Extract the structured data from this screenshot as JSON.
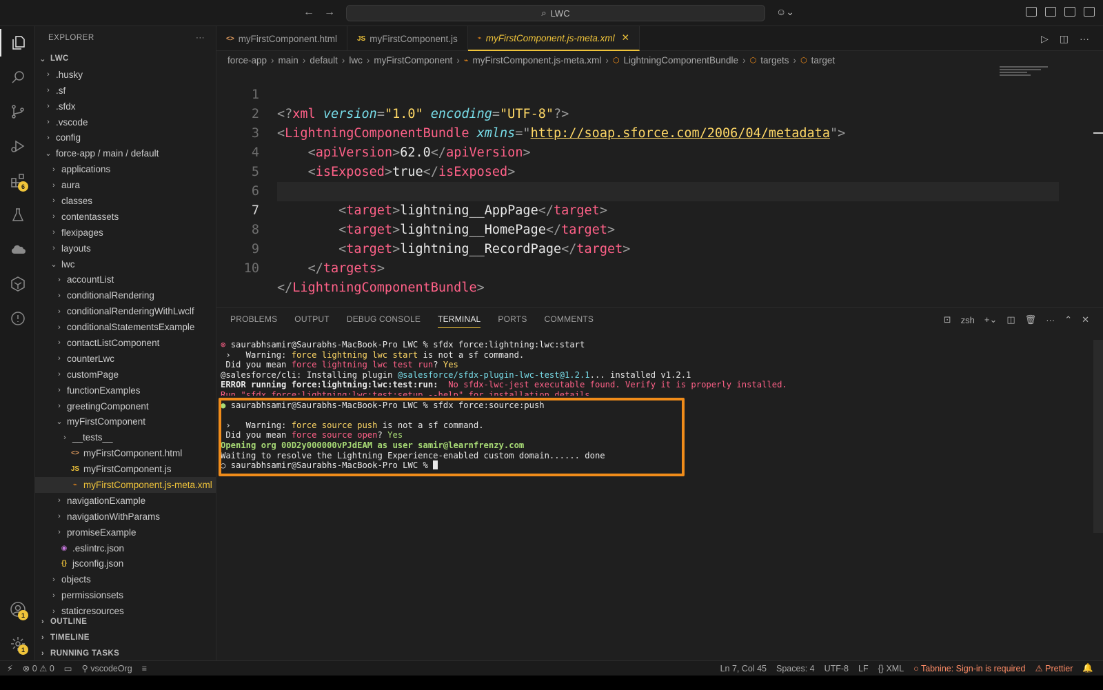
{
  "titlebar": {
    "search_text": "LWC"
  },
  "activity": {
    "extensions_badge": "6",
    "accounts_badge": "1",
    "settings_badge": "1"
  },
  "sidebar": {
    "title": "EXPLORER",
    "more": "···",
    "root": "LWC",
    "items": [
      {
        "label": ".husky",
        "depth": 1,
        "chev": "›"
      },
      {
        "label": ".sf",
        "depth": 1,
        "chev": "›"
      },
      {
        "label": ".sfdx",
        "depth": 1,
        "chev": "›"
      },
      {
        "label": ".vscode",
        "depth": 1,
        "chev": "›"
      },
      {
        "label": "config",
        "depth": 1,
        "chev": "›"
      },
      {
        "label": "force-app / main / default",
        "depth": 1,
        "chev": "⌄"
      },
      {
        "label": "applications",
        "depth": 2,
        "chev": "›"
      },
      {
        "label": "aura",
        "depth": 2,
        "chev": "›"
      },
      {
        "label": "classes",
        "depth": 2,
        "chev": "›"
      },
      {
        "label": "contentassets",
        "depth": 2,
        "chev": "›"
      },
      {
        "label": "flexipages",
        "depth": 2,
        "chev": "›"
      },
      {
        "label": "layouts",
        "depth": 2,
        "chev": "›"
      },
      {
        "label": "lwc",
        "depth": 2,
        "chev": "⌄"
      },
      {
        "label": "accountList",
        "depth": 3,
        "chev": "›"
      },
      {
        "label": "conditionalRendering",
        "depth": 3,
        "chev": "›"
      },
      {
        "label": "conditionalRenderingWithLwclf",
        "depth": 3,
        "chev": "›"
      },
      {
        "label": "conditionalStatementsExample",
        "depth": 3,
        "chev": "›"
      },
      {
        "label": "contactListComponent",
        "depth": 3,
        "chev": "›"
      },
      {
        "label": "counterLwc",
        "depth": 3,
        "chev": "›"
      },
      {
        "label": "customPage",
        "depth": 3,
        "chev": "›"
      },
      {
        "label": "functionExamples",
        "depth": 3,
        "chev": "›"
      },
      {
        "label": "greetingComponent",
        "depth": 3,
        "chev": "›"
      },
      {
        "label": "myFirstComponent",
        "depth": 3,
        "chev": "⌄"
      },
      {
        "label": "__tests__",
        "depth": 4,
        "chev": "›"
      },
      {
        "label": "myFirstComponent.html",
        "depth": 4,
        "icon": "<>",
        "icon_color": "#e8a060"
      },
      {
        "label": "myFirstComponent.js",
        "depth": 4,
        "icon": "JS",
        "icon_color": "#f0c43a"
      },
      {
        "label": "myFirstComponent.js-meta.xml",
        "depth": 4,
        "icon": "⌁",
        "icon_color": "#f08c1a",
        "selected": true
      },
      {
        "label": "navigationExample",
        "depth": 3,
        "chev": "›"
      },
      {
        "label": "navigationWithParams",
        "depth": 3,
        "chev": "›"
      },
      {
        "label": "promiseExample",
        "depth": 3,
        "chev": "›"
      },
      {
        "label": ".eslintrc.json",
        "depth": 2,
        "icon": "◉",
        "icon_color": "#c678dd"
      },
      {
        "label": "jsconfig.json",
        "depth": 2,
        "icon": "{}",
        "icon_color": "#f0c43a"
      },
      {
        "label": "objects",
        "depth": 2,
        "chev": "›"
      },
      {
        "label": "permissionsets",
        "depth": 2,
        "chev": "›"
      },
      {
        "label": "staticresources",
        "depth": 2,
        "chev": "›"
      }
    ],
    "outline": "OUTLINE",
    "timeline": "TIMELINE",
    "running_tasks": "RUNNING TASKS"
  },
  "tabs": [
    {
      "label": "myFirstComponent.html",
      "icon": "<>",
      "icon_color": "#e8a060"
    },
    {
      "label": "myFirstComponent.js",
      "icon": "JS",
      "icon_color": "#f0c43a"
    },
    {
      "label": "myFirstComponent.js-meta.xml",
      "icon": "⌁",
      "icon_color": "#f08c1a",
      "active": true
    }
  ],
  "breadcrumb": [
    "force-app",
    "main",
    "default",
    "lwc",
    "myFirstComponent",
    "myFirstComponent.js-meta.xml",
    "LightningComponentBundle",
    "targets",
    "target"
  ],
  "code": {
    "current_line": 7,
    "xml_decl": {
      "version": "\"1.0\"",
      "encoding": "\"UTF-8\""
    },
    "bundle_tag": "LightningComponentBundle",
    "xmlns_attr": "xmlns",
    "xmlns_value": "http://soap.sforce.com/2006/04/metadata",
    "api_tag": "apiVersion",
    "api_value": "62.0",
    "exposed_tag": "isExposed",
    "exposed_value": "true",
    "targets_tag": "targets",
    "target_tag": "target",
    "targets": [
      "lightning__AppPage",
      "lightning__HomePage",
      "lightning__RecordPage"
    ]
  },
  "panel": {
    "tabs": [
      "PROBLEMS",
      "OUTPUT",
      "DEBUG CONSOLE",
      "TERMINAL",
      "PORTS",
      "COMMENTS"
    ],
    "active_tab": "TERMINAL",
    "shell": "zsh"
  },
  "terminal": {
    "prompt": "saurabhsamir@Saurabhs-MacBook-Pro LWC %",
    "cmd1": "sfdx force:lightning:lwc:start",
    "warn1_pre": " ›   Warning: ",
    "warn1_cmd": "force lightning lwc start",
    "warn_post": " is not a sf command.",
    "mean1_pre": " Did you mean ",
    "mean1_cmd": "force lightning lwc test run",
    "mean_q": "? ",
    "yes": "Yes",
    "install_pre": "@salesforce/cli: Installing plugin ",
    "install_pkg": "@salesforce/sfdx-plugin-lwc-test@1.2.1",
    "install_post": "... installed v1.2.1",
    "error_pre": "ERROR running force:lightning:lwc:test:run:",
    "error_msg": "  No sfdx-lwc-jest executable found. Verify it is properly installed.",
    "clipped_line": "Run \"sfdx force:lightning:lwc:test:setup --help\" for installation details.",
    "cmd2": "sfdx force:source:push",
    "warn2_cmd": "force source push",
    "mean2_cmd": "force source open",
    "opening": "Opening org 00D2y000000vPJdEAM as user samir@learnfrenzy.com",
    "waiting": "Waiting to resolve the Lightning Experience-enabled custom domain...... done"
  },
  "status": {
    "errors": "0",
    "warnings": "0",
    "org": "vscodeOrg",
    "position": "Ln 7, Col 45",
    "spaces": "Spaces: 4",
    "encoding": "UTF-8",
    "eol": "LF",
    "language": "XML",
    "tabnine": "Tabnine: Sign-in is required",
    "prettier": "Prettier"
  }
}
